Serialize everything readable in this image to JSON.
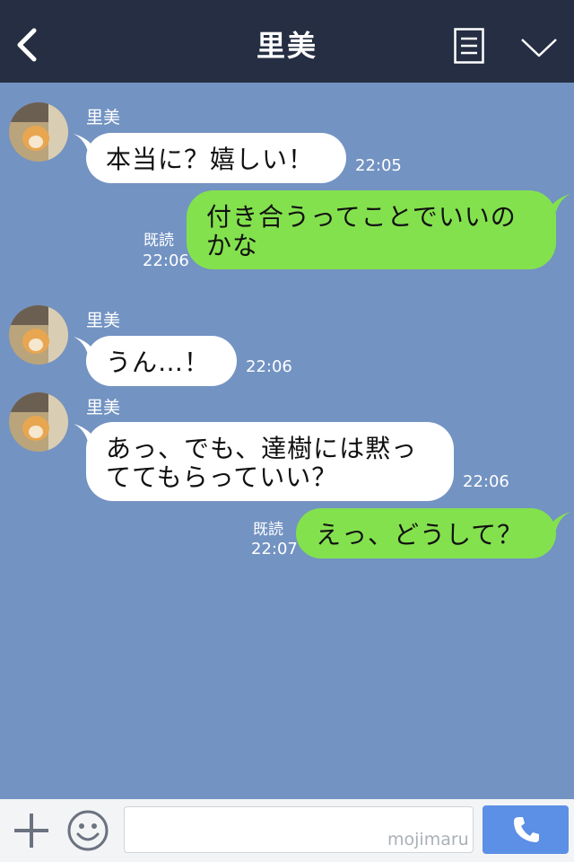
{
  "header": {
    "title": "里美"
  },
  "messages": [
    {
      "sender": "里美",
      "text": "本当に？嬉しい！",
      "time": "22:05"
    },
    {
      "read": "既読",
      "time": "22:06",
      "text_line1": "付き合うってことでいいの",
      "text_line2": "かな"
    },
    {
      "sender": "里美",
      "text": "うん…！",
      "time": "22:06"
    },
    {
      "sender": "里美",
      "text_line1": "あっ、でも、達樹には黙っ",
      "text_line2": "ててもらっていい？",
      "time": "22:06"
    },
    {
      "read": "既読",
      "time": "22:07",
      "text": "えっ、どうして？"
    }
  ],
  "input": {
    "watermark": "mojimaru"
  },
  "colors": {
    "header_bg": "#252e42",
    "chat_bg": "#7393c2",
    "outgoing_bubble": "#84e14e",
    "incoming_bubble": "#ffffff",
    "call_button": "#5c8fe6"
  },
  "icons": [
    "back-icon",
    "menu-icon",
    "chevron-down-icon",
    "plus-icon",
    "emoji-icon",
    "phone-icon"
  ]
}
